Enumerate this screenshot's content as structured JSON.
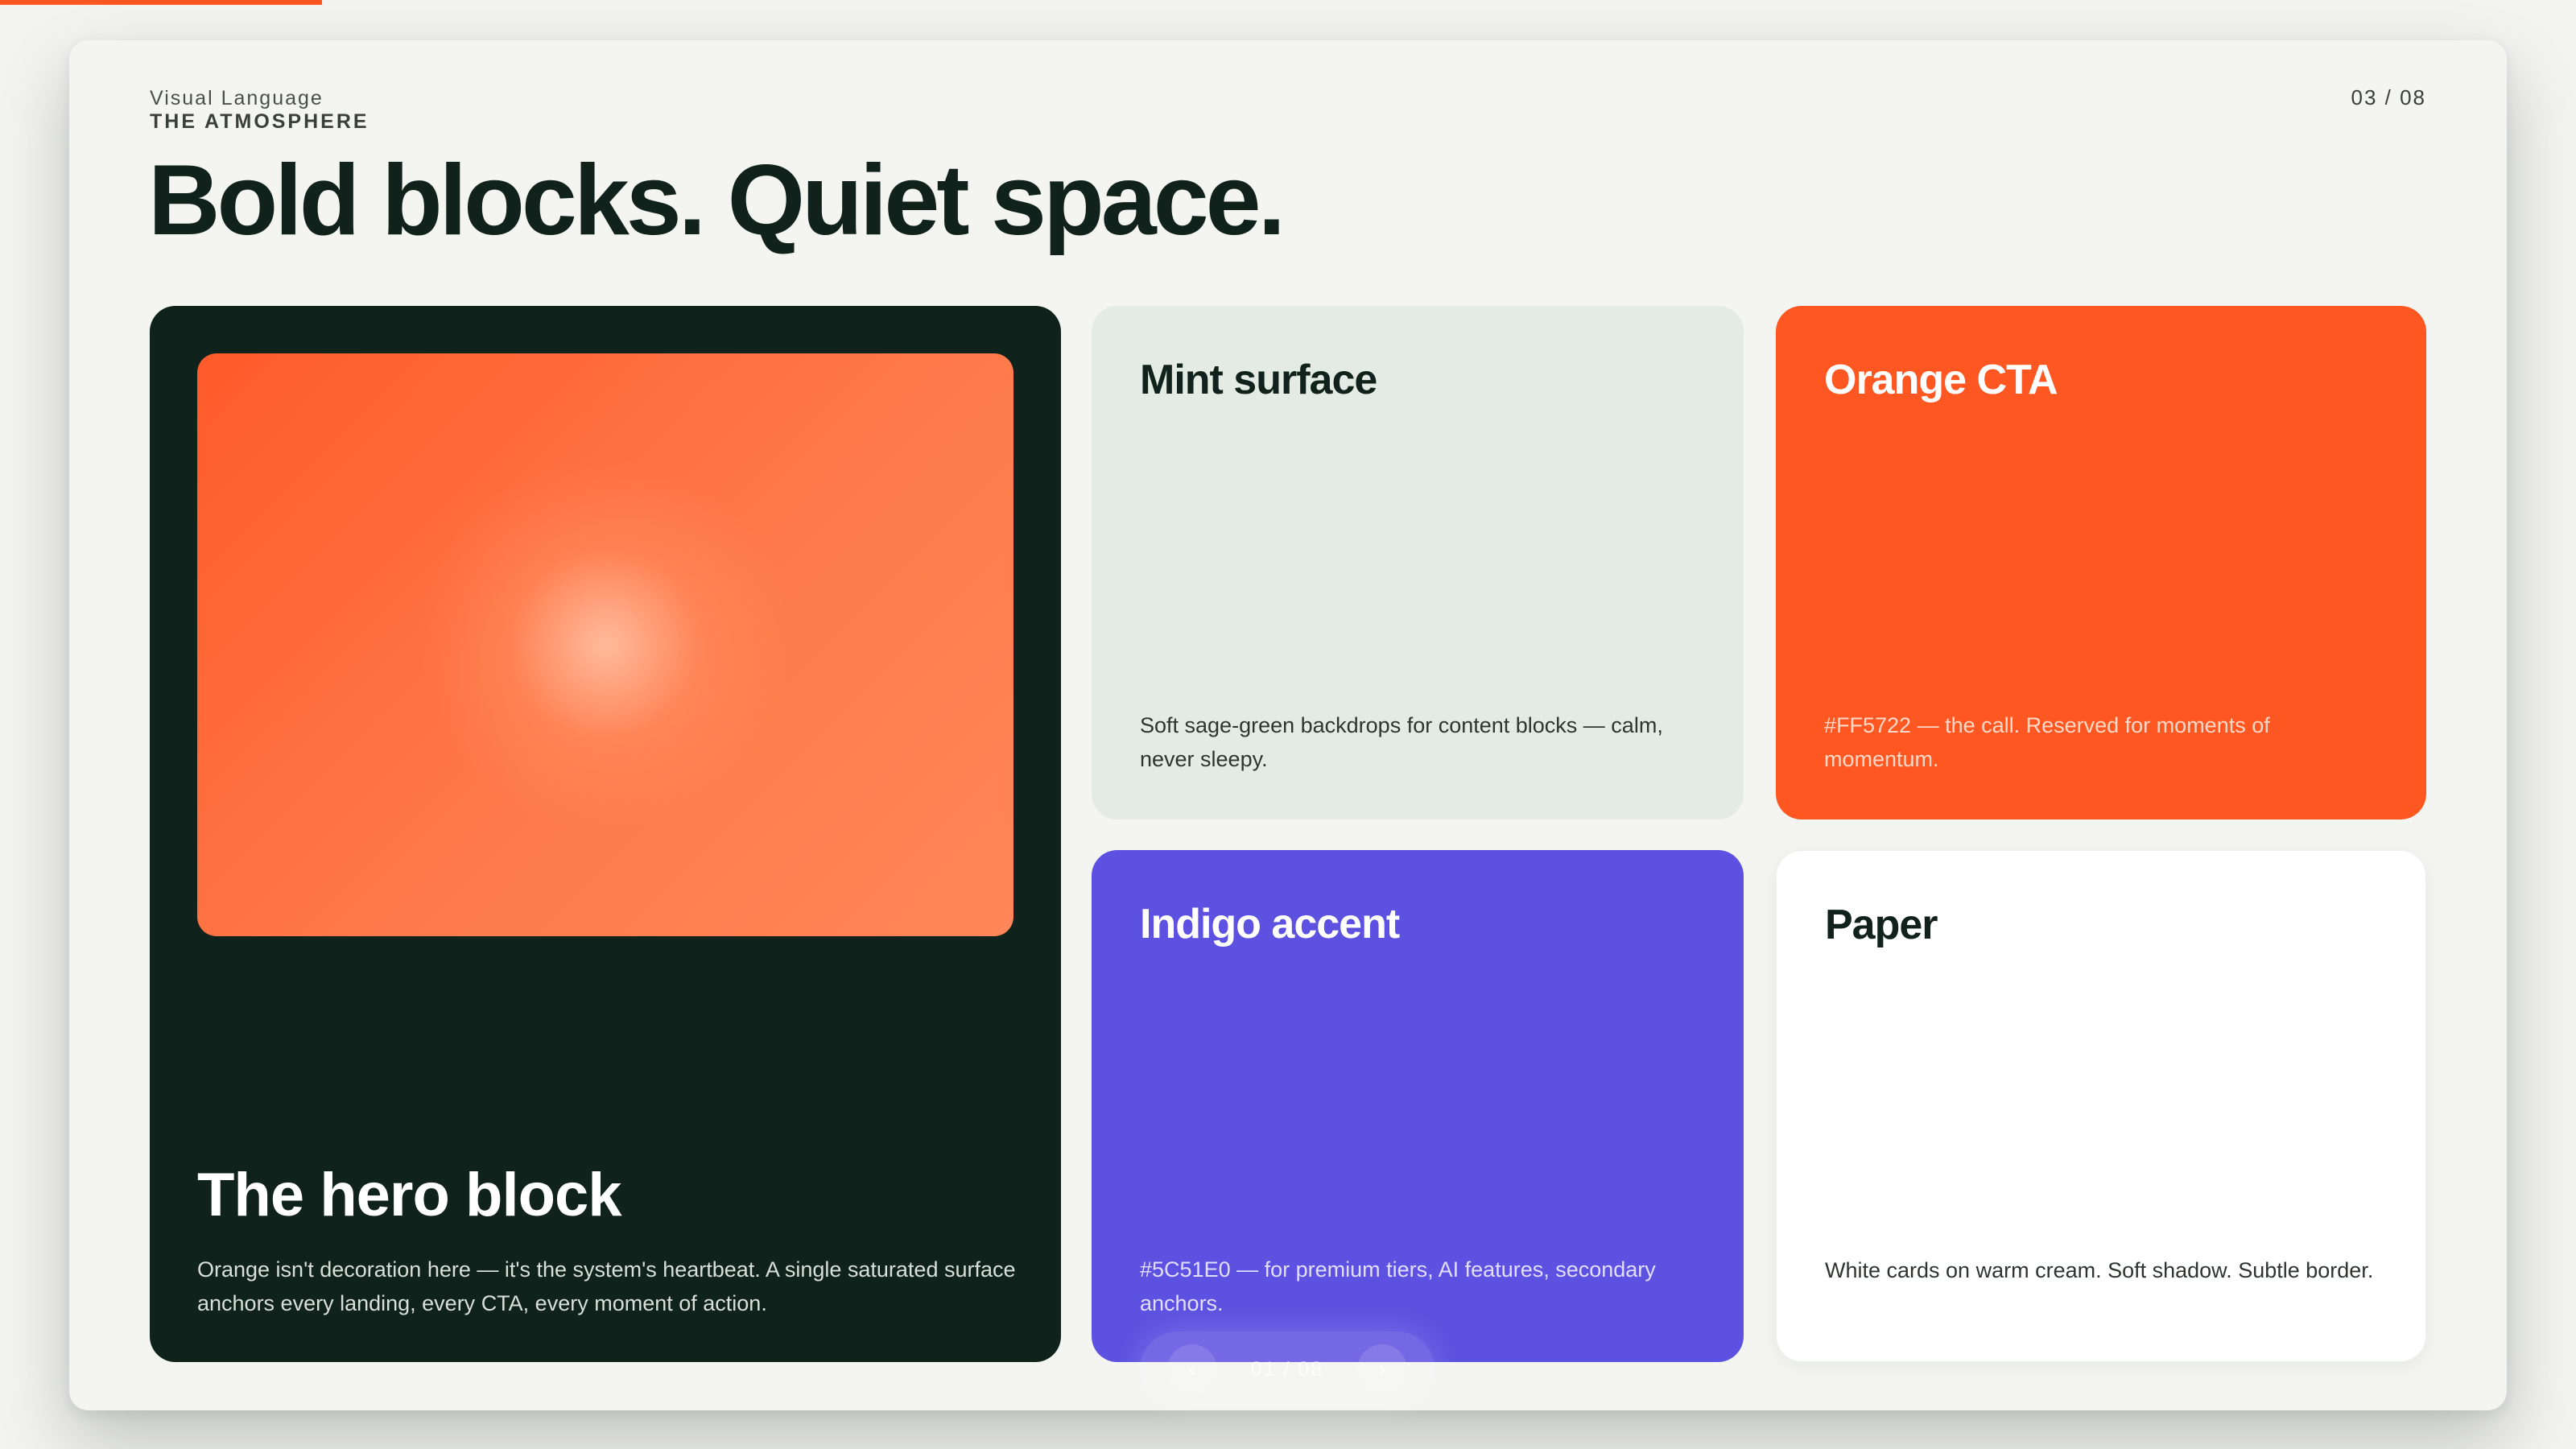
{
  "deck": {
    "progress_fraction": 0.125
  },
  "slide": {
    "eyebrow": "Visual Language",
    "section": "THE ATMOSPHERE",
    "page_counter": "03 / 08",
    "headline": "Bold blocks. Quiet space."
  },
  "cards": {
    "hero": {
      "title": "The hero block",
      "body": "Orange isn't decoration here — it's the system's heartbeat. A single saturated surface anchors every landing, every CTA, every moment of action."
    },
    "mint": {
      "title": "Mint surface",
      "body": "Soft sage-green backdrops for content blocks — calm, never sleepy."
    },
    "orange": {
      "title": "Orange CTA",
      "body": "#FF5722 — the call. Reserved for moments of momentum."
    },
    "indigo": {
      "title": "Indigo accent",
      "body": "#5C51E0 — for premium tiers, AI features, secondary anchors."
    },
    "paper": {
      "title": "Paper",
      "body": "White cards on warm cream. Soft shadow. Subtle border."
    }
  },
  "pager": {
    "prev_icon": "chevron-left-icon",
    "prev_glyph": "‹",
    "counter": "01 / 08",
    "next_icon": "chevron-right-icon",
    "next_glyph": "›"
  },
  "colors": {
    "orange": "#FF5722",
    "indigo": "#5C51E0",
    "ink": "#10221C",
    "mint": "#E4EBE4",
    "paper": "#FFFFFF",
    "cream": "#F4F5F1"
  }
}
